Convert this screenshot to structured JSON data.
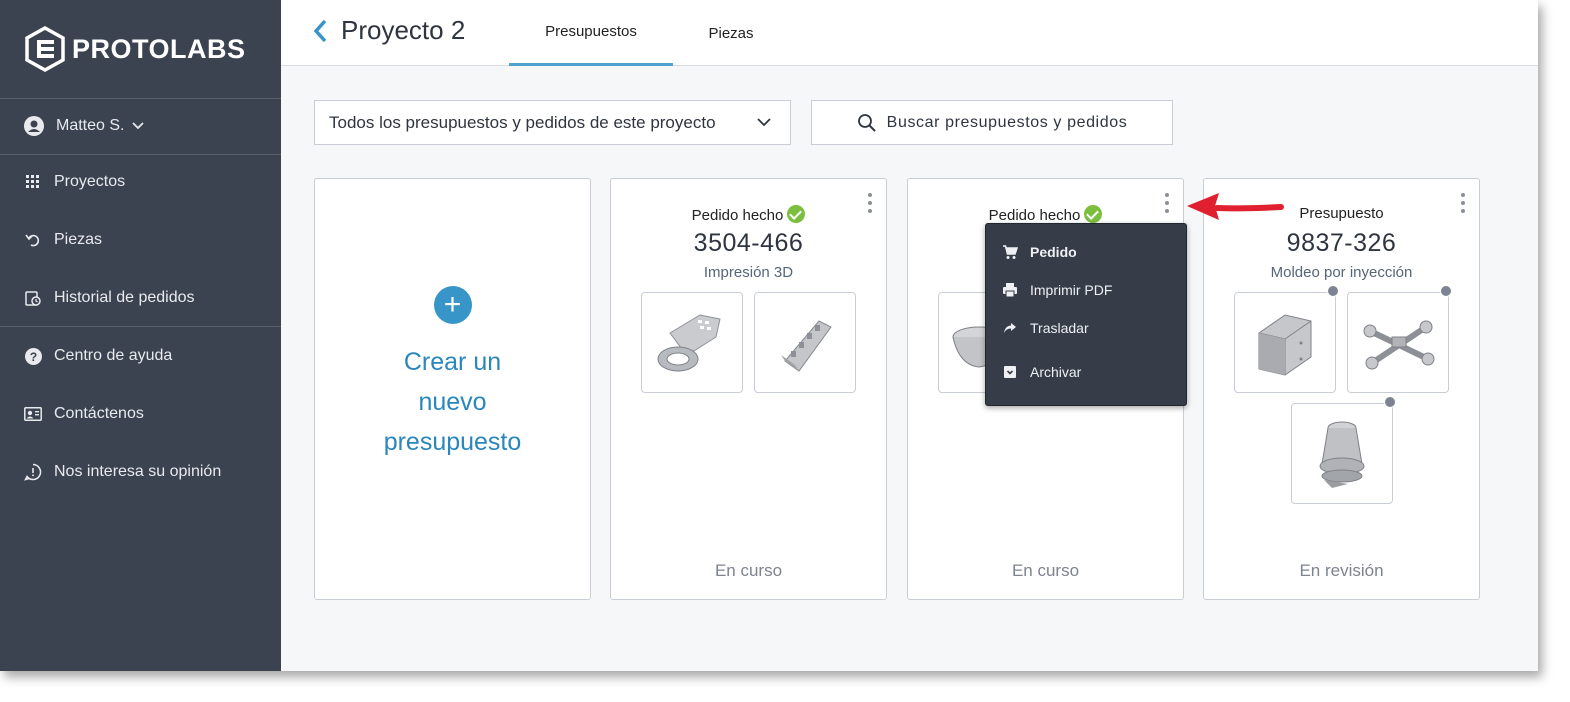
{
  "brand": {
    "name": "PROTOLABS"
  },
  "sidebar": {
    "user": "Matteo S.",
    "items": [
      {
        "label": "Proyectos",
        "icon": "grid-icon"
      },
      {
        "label": "Piezas",
        "icon": "undo-icon"
      },
      {
        "label": "Historial de pedidos",
        "icon": "order-history-icon"
      },
      {
        "label": "Centro de ayuda",
        "icon": "help-icon"
      },
      {
        "label": "Contáctenos",
        "icon": "contact-card-icon"
      },
      {
        "label": "Nos interesa su opinión",
        "icon": "feedback-icon"
      }
    ]
  },
  "header": {
    "title": "Proyecto 2",
    "tabs": [
      {
        "label": "Presupuestos",
        "active": true
      },
      {
        "label": "Piezas",
        "active": false
      }
    ]
  },
  "filter": {
    "value": "Todos los presupuestos y pedidos de este proyecto"
  },
  "search": {
    "label": "Buscar presupuestos y pedidos"
  },
  "new_quote": {
    "line1": "Crear un",
    "line2": "nuevo",
    "line3": "presupuesto"
  },
  "cards": [
    {
      "status": "Pedido hecho",
      "number": "3504-466",
      "process": "Impresión 3D",
      "footer": "En curso"
    },
    {
      "status": "Pedido hecho",
      "number": "",
      "process": "",
      "footer": "En curso"
    },
    {
      "status": "Presupuesto",
      "number": "9837-326",
      "process": "Moldeo por inyección",
      "footer": "En revisión"
    }
  ],
  "menu": {
    "items": [
      {
        "label": "Pedido",
        "icon": "cart-icon"
      },
      {
        "label": "Imprimir PDF",
        "icon": "printer-icon"
      },
      {
        "label": "Trasladar",
        "icon": "share-arrow-icon"
      },
      {
        "label": "Archivar",
        "icon": "archive-icon"
      }
    ]
  },
  "colors": {
    "sidebar": "#3b4350",
    "accent": "#3795c8",
    "success": "#7cbf3f",
    "callout": "#e0202e"
  }
}
